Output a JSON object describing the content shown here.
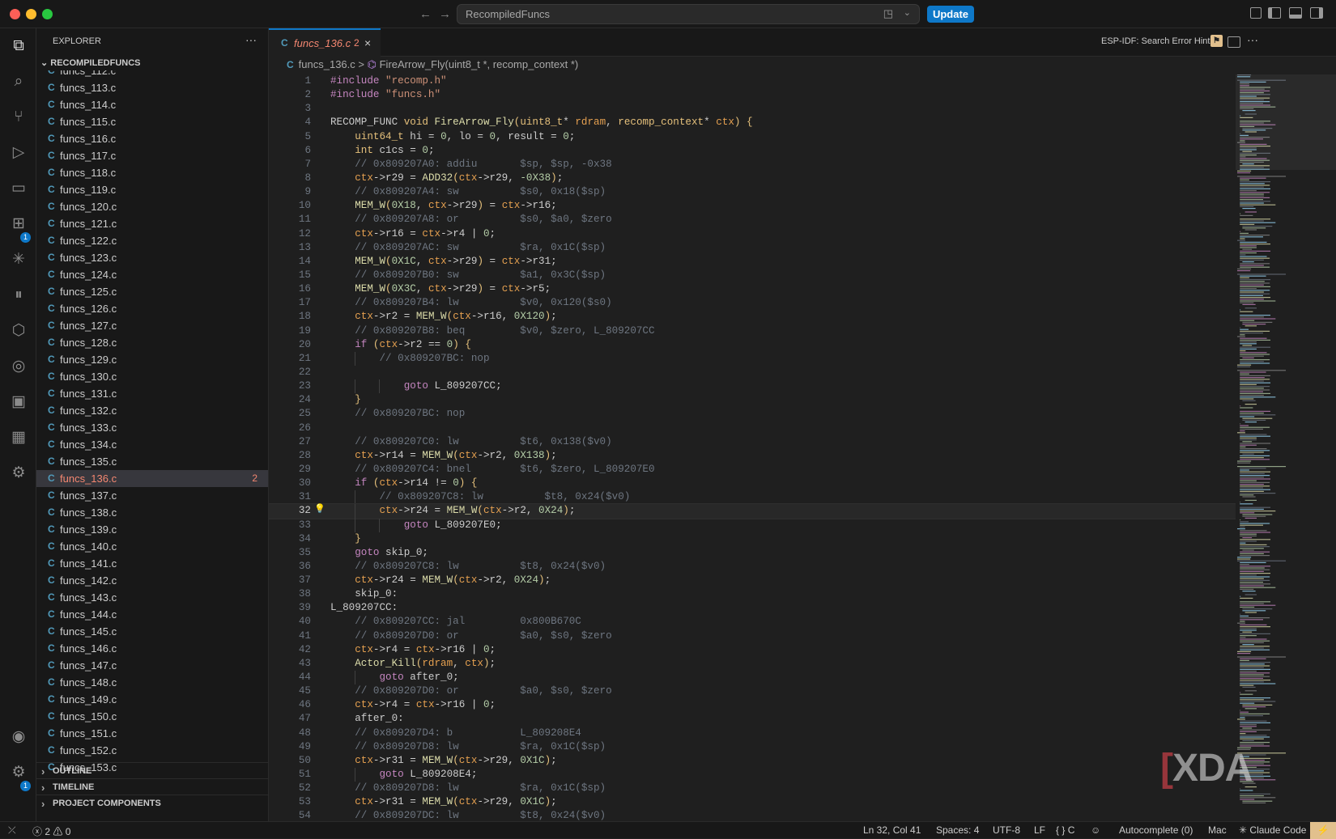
{
  "titlebar": {
    "search_text": "RecompiledFuncs",
    "update_label": "Update"
  },
  "sidebar": {
    "title": "EXPLORER",
    "more": "···",
    "root": "RECOMPILEDFUNCS",
    "files": [
      {
        "name": "funcs_112.c"
      },
      {
        "name": "funcs_113.c"
      },
      {
        "name": "funcs_114.c"
      },
      {
        "name": "funcs_115.c"
      },
      {
        "name": "funcs_116.c"
      },
      {
        "name": "funcs_117.c"
      },
      {
        "name": "funcs_118.c"
      },
      {
        "name": "funcs_119.c"
      },
      {
        "name": "funcs_120.c"
      },
      {
        "name": "funcs_121.c"
      },
      {
        "name": "funcs_122.c"
      },
      {
        "name": "funcs_123.c"
      },
      {
        "name": "funcs_124.c"
      },
      {
        "name": "funcs_125.c"
      },
      {
        "name": "funcs_126.c"
      },
      {
        "name": "funcs_127.c"
      },
      {
        "name": "funcs_128.c"
      },
      {
        "name": "funcs_129.c"
      },
      {
        "name": "funcs_130.c"
      },
      {
        "name": "funcs_131.c"
      },
      {
        "name": "funcs_132.c"
      },
      {
        "name": "funcs_133.c"
      },
      {
        "name": "funcs_134.c"
      },
      {
        "name": "funcs_135.c"
      },
      {
        "name": "funcs_136.c",
        "selected": true,
        "problems": "2"
      },
      {
        "name": "funcs_137.c"
      },
      {
        "name": "funcs_138.c"
      },
      {
        "name": "funcs_139.c"
      },
      {
        "name": "funcs_140.c"
      },
      {
        "name": "funcs_141.c"
      },
      {
        "name": "funcs_142.c"
      },
      {
        "name": "funcs_143.c"
      },
      {
        "name": "funcs_144.c"
      },
      {
        "name": "funcs_145.c"
      },
      {
        "name": "funcs_146.c"
      },
      {
        "name": "funcs_147.c"
      },
      {
        "name": "funcs_148.c"
      },
      {
        "name": "funcs_149.c"
      },
      {
        "name": "funcs_150.c"
      },
      {
        "name": "funcs_151.c"
      },
      {
        "name": "funcs_152.c"
      },
      {
        "name": "funcs_153.c"
      }
    ],
    "sections": {
      "outline": "OUTLINE",
      "timeline": "TIMELINE",
      "project": "PROJECT COMPONENTS"
    },
    "file_icon": "C"
  },
  "tab": {
    "icon": "C",
    "name": "funcs_136.c",
    "problems": "2",
    "close": "×"
  },
  "editor_actions": {
    "hint": "ESP-IDF: Search Error Hint"
  },
  "breadcrumb": {
    "file": "funcs_136.c",
    "sep": ">",
    "symbol": "FireArrow_Fly(uint8_t *, recomp_context *)"
  },
  "code": {
    "current_line": 32,
    "lines": [
      "#include \"recomp.h\"",
      "#include \"funcs.h\"",
      "",
      "RECOMP_FUNC void FireArrow_Fly(uint8_t* rdram, recomp_context* ctx) {",
      "    uint64_t hi = 0, lo = 0, result = 0;",
      "    int c1cs = 0;",
      "    // 0x809207A0: addiu       $sp, $sp, -0x38",
      "    ctx->r29 = ADD32(ctx->r29, -0X38);",
      "    // 0x809207A4: sw          $s0, 0x18($sp)",
      "    MEM_W(0X18, ctx->r29) = ctx->r16;",
      "    // 0x809207A8: or          $s0, $a0, $zero",
      "    ctx->r16 = ctx->r4 | 0;",
      "    // 0x809207AC: sw          $ra, 0x1C($sp)",
      "    MEM_W(0X1C, ctx->r29) = ctx->r31;",
      "    // 0x809207B0: sw          $a1, 0x3C($sp)",
      "    MEM_W(0X3C, ctx->r29) = ctx->r5;",
      "    // 0x809207B4: lw          $v0, 0x120($s0)",
      "    ctx->r2 = MEM_W(ctx->r16, 0X120);",
      "    // 0x809207B8: beq         $v0, $zero, L_809207CC",
      "    if (ctx->r2 == 0) {",
      "        // 0x809207BC: nop",
      "",
      "            goto L_809207CC;",
      "    }",
      "    // 0x809207BC: nop",
      "",
      "    // 0x809207C0: lw          $t6, 0x138($v0)",
      "    ctx->r14 = MEM_W(ctx->r2, 0X138);",
      "    // 0x809207C4: bnel        $t6, $zero, L_809207E0",
      "    if (ctx->r14 != 0) {",
      "        // 0x809207C8: lw          $t8, 0x24($v0)",
      "        ctx->r24 = MEM_W(ctx->r2, 0X24);",
      "            goto L_809207E0;",
      "    }",
      "    goto skip_0;",
      "    // 0x809207C8: lw          $t8, 0x24($v0)",
      "    ctx->r24 = MEM_W(ctx->r2, 0X24);",
      "    skip_0:",
      "L_809207CC:",
      "    // 0x809207CC: jal         0x800B670C",
      "    // 0x809207D0: or          $a0, $s0, $zero",
      "    ctx->r4 = ctx->r16 | 0;",
      "    Actor_Kill(rdram, ctx);",
      "        goto after_0;",
      "    // 0x809207D0: or          $a0, $s0, $zero",
      "    ctx->r4 = ctx->r16 | 0;",
      "    after_0:",
      "    // 0x809207D4: b           L_809208E4",
      "    // 0x809207D8: lw          $ra, 0x1C($sp)",
      "    ctx->r31 = MEM_W(ctx->r29, 0X1C);",
      "        goto L_809208E4;",
      "    // 0x809207D8: lw          $ra, 0x1C($sp)",
      "    ctx->r31 = MEM_W(ctx->r29, 0X1C);",
      "    // 0x809207DC: lw          $t8, 0x24($v0)"
    ]
  },
  "status": {
    "errors": "2",
    "warnings": "0",
    "position": "Ln 32, Col 41",
    "spaces": "Spaces: 4",
    "encoding": "UTF-8",
    "eol": "LF",
    "language": "C",
    "autocomplete": "Autocomplete (0)",
    "platform": "Mac",
    "claude": "Claude Code"
  },
  "watermark": {
    "bracket": "[",
    "text": "XDA"
  },
  "colors": {
    "accent": "#0e78c8",
    "keyword": "#c586c0",
    "type": "#e5c07b",
    "string": "#ce9178",
    "comment": "#6a9955",
    "number": "#b5cea8",
    "error": "#f48771"
  }
}
